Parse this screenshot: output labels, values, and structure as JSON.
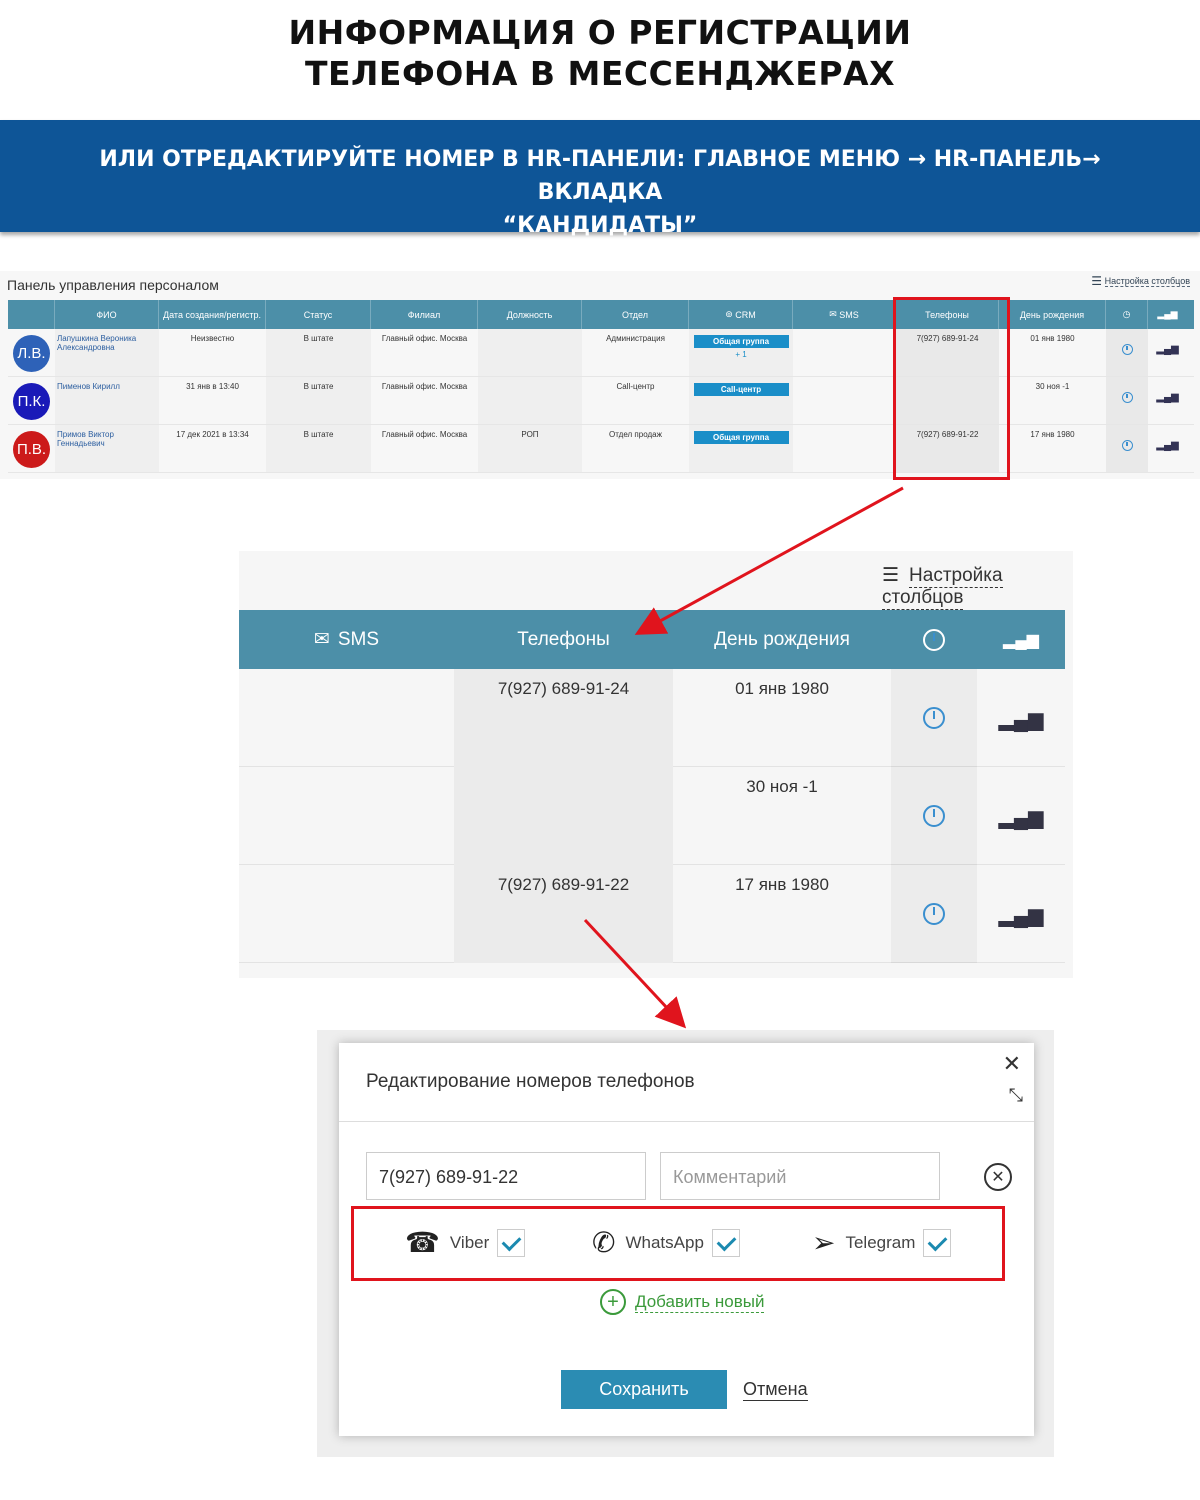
{
  "heading": {
    "line1": "ИНФОРМАЦИЯ О РЕГИСТРАЦИИ",
    "line2": "ТЕЛЕФОНА В МЕССЕНДЖЕРАХ"
  },
  "banner": {
    "line1": "ИЛИ ОТРЕДАКТИРУЙТЕ НОМЕР В HR-ПАНЕЛИ: ГЛАВНОЕ МЕНЮ → HR-ПАНЕЛЬ→ ВКЛАДКА",
    "line2": "“КАНДИДАТЫ”"
  },
  "panel1": {
    "title": "Панель управления персоналом",
    "settings_label": "Настройка столбцов",
    "columns": [
      "ФИО",
      "Дата создания/регистр.",
      "Статус",
      "Филиал",
      "Должность",
      "Отдел",
      "CRM",
      "SMS",
      "Телефоны",
      "День рождения"
    ],
    "rows": [
      {
        "initials": "Л.В.",
        "avatar_color": "#2e62b8",
        "fio": "Лапушкина Вероника Александровна",
        "date": "Неизвестно",
        "status": "В штате",
        "filial": "Главный офис. Москва",
        "dolj": "",
        "otdel": "Администрация",
        "crm": "Общая группа",
        "crm_extra": "+ 1",
        "sms": "",
        "phone": "7(927) 689-91-24",
        "bday": "01 янв 1980"
      },
      {
        "initials": "П.К.",
        "avatar_color": "#1a1ab8",
        "fio": "Пименов Кирилл",
        "date": "31 янв в 13:40",
        "status": "В штате",
        "filial": "Главный офис. Москва",
        "dolj": "",
        "otdel": "Call-центр",
        "crm": "Call-центр",
        "crm_extra": "",
        "sms": "",
        "phone": "",
        "bday": "30 ноя -1"
      },
      {
        "initials": "П.В.",
        "avatar_color": "#cc1a1a",
        "fio": "Примов Виктор Геннадьевич",
        "date": "17 дек 2021 в 13:34",
        "status": "В штате",
        "filial": "Главный офис. Москва",
        "dolj": "РОП",
        "otdel": "Отдел продаж",
        "crm": "Общая группа",
        "crm_extra": "",
        "sms": "",
        "phone": "7(927) 689-91-22",
        "bday": "17 янв 1980"
      }
    ]
  },
  "panel2": {
    "settings_label": "Настройка столбцов",
    "col_sms": "SMS",
    "col_phones": "Телефоны",
    "col_bday": "День рождения",
    "rows": [
      {
        "phone": "7(927) 689-91-24",
        "bday": "01 янв 1980"
      },
      {
        "phone": "",
        "bday": "30 ноя -1"
      },
      {
        "phone": "7(927) 689-91-22",
        "bday": "17 янв 1980"
      }
    ]
  },
  "dialog": {
    "title": "Редактирование номеров телефонов",
    "phone_value": "7(927) 689-91-22",
    "comment_placeholder": "Комментарий",
    "messengers": [
      {
        "name": "Viber",
        "checked": true
      },
      {
        "name": "WhatsApp",
        "checked": true
      },
      {
        "name": "Telegram",
        "checked": true
      }
    ],
    "add_new": "Добавить новый",
    "save": "Сохранить",
    "cancel": "Отмена"
  },
  "colors": {
    "banner": "#0e5597",
    "table_header": "#4c8fa8",
    "highlight": "#e0141d",
    "save_button": "#2b8cb3",
    "add_link": "#3b9a3b"
  }
}
